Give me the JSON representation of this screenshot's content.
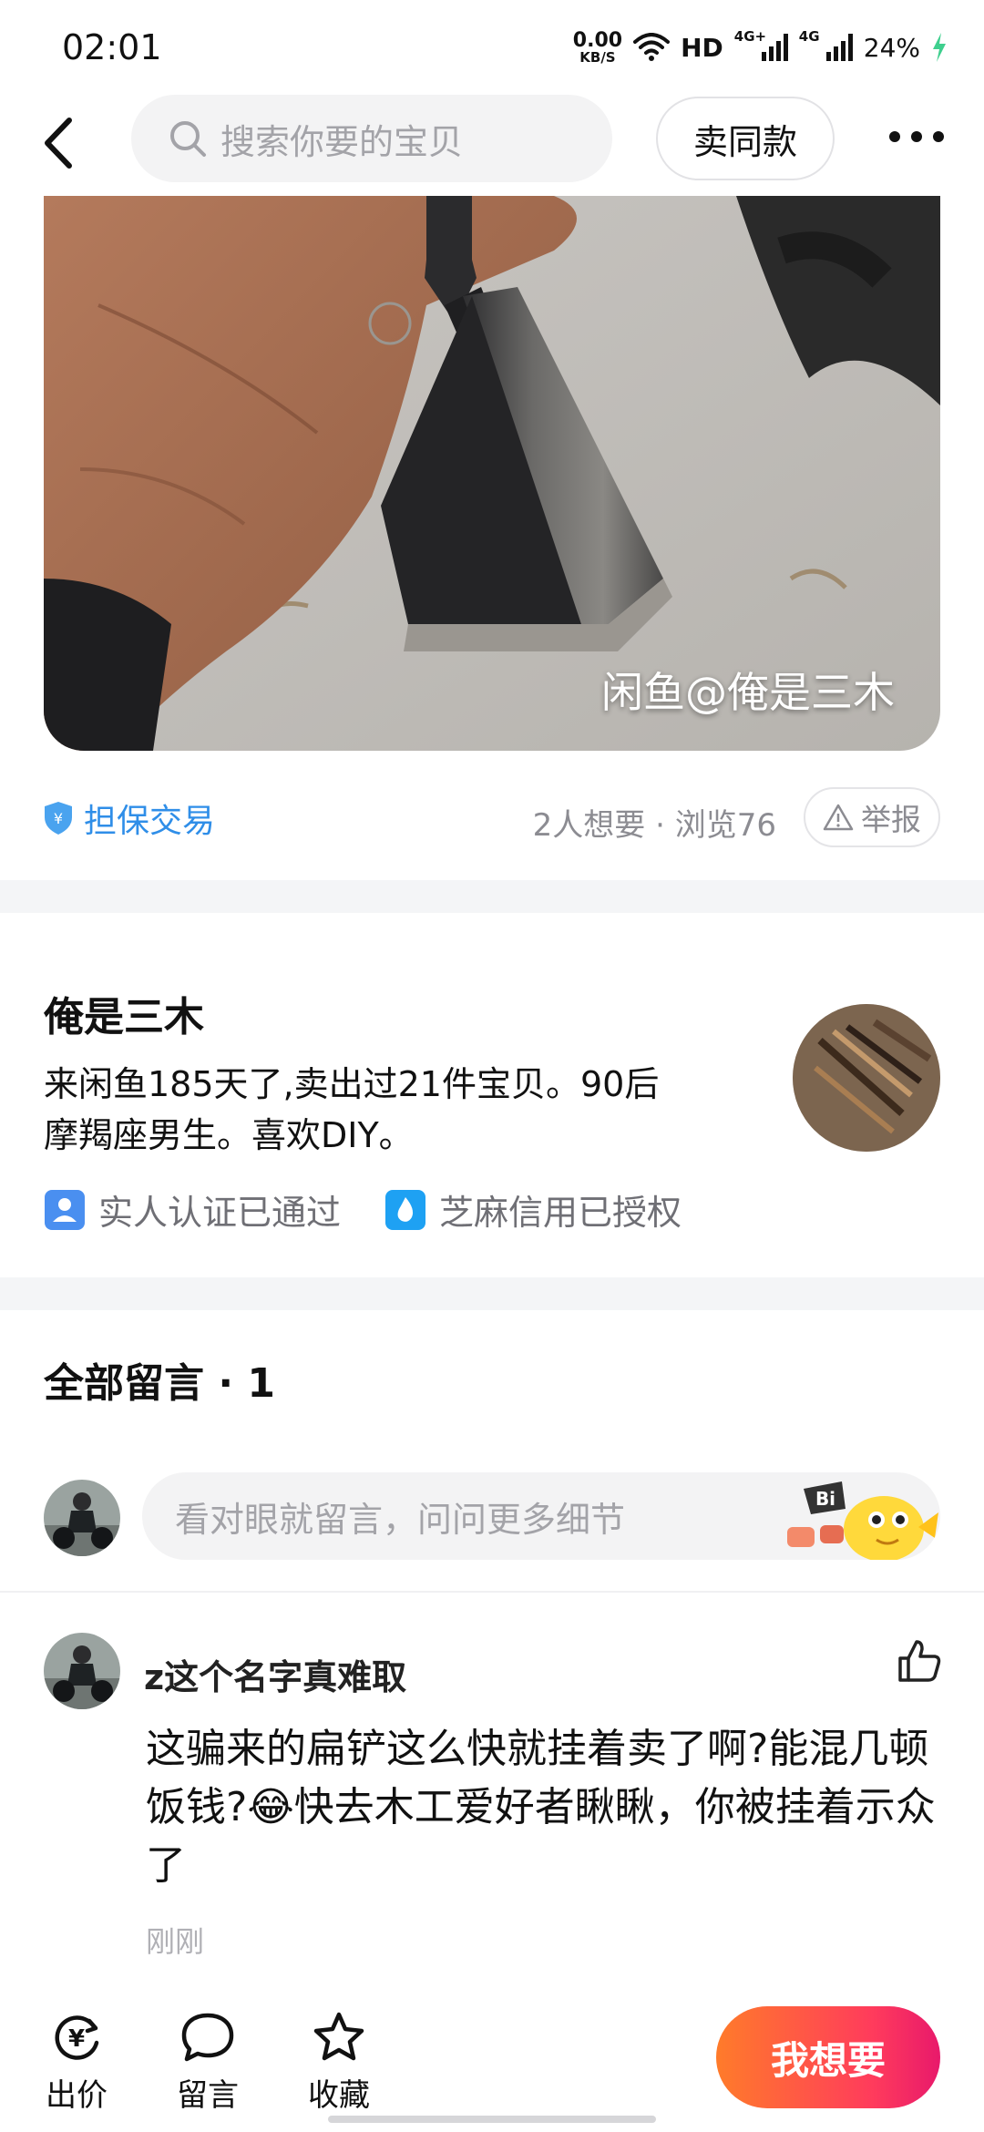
{
  "status_bar": {
    "time": "02:01",
    "net_speed_value": "0.00",
    "net_speed_unit": "KB/S",
    "hd_label": "HD",
    "signal1_label": "4G+",
    "signal2_label": "4G",
    "battery": "24%"
  },
  "nav": {
    "search_placeholder": "搜索你要的宝贝",
    "sell_same_label": "卖同款"
  },
  "product": {
    "watermark": "闲鱼@俺是三木",
    "guarantee_label": "担保交易",
    "stats": "2人想要 · 浏览76",
    "report_label": "举报"
  },
  "seller": {
    "name": "俺是三木",
    "bio_line1": "来闲鱼185天了,卖出过21件宝贝。90后",
    "bio_line2": "摩羯座男生。喜欢DIY。",
    "badge_identity": "实人认证已通过",
    "badge_credit": "芝麻信用已授权"
  },
  "comments": {
    "title": "全部留言 · 1",
    "input_placeholder": "看对眼就留言，问问更多细节",
    "mascot_label": "Bi",
    "items": [
      {
        "user": "z这个名字真难取",
        "text": "这骗来的扁铲这么快就挂着卖了啊?能混几顿饭钱?😂快去木工爱好者瞅瞅，你被挂着示众了",
        "time": "刚刚"
      }
    ]
  },
  "bottom_bar": {
    "bid_label": "出价",
    "bid_symbol": "¥",
    "comment_label": "留言",
    "favorite_label": "收藏",
    "want_label": "我想要"
  },
  "colors": {
    "accent_blue": "#2f8ee8",
    "want_gradient_start": "#ff7b2a",
    "want_gradient_end": "#e8196b",
    "gap_gray": "#f4f5f7"
  }
}
